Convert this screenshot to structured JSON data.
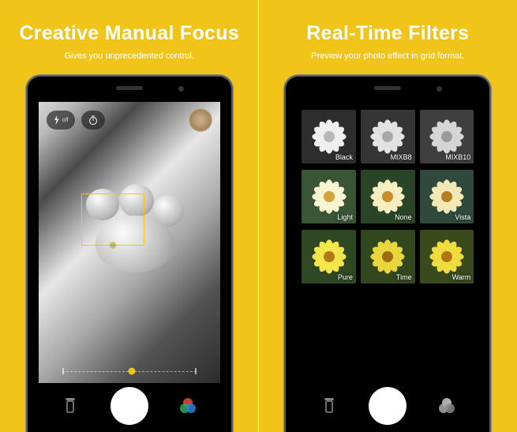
{
  "panels": {
    "left": {
      "title": "Creative Manual Focus",
      "subtitle": "Gives you unprecedented control.",
      "top_controls": {
        "flash_label": "off"
      }
    },
    "right": {
      "title": "Real-Time Filters",
      "subtitle": "Preview your photo effect in grid format.",
      "filters": [
        {
          "label": "Black",
          "bg": "#2d2d2d",
          "petal": "#efefef",
          "center": "#b8b8b8"
        },
        {
          "label": "MIXB8",
          "bg": "#353535",
          "petal": "#e2e2e2",
          "center": "#a8a8a8"
        },
        {
          "label": "MIXB10",
          "bg": "#3f3f3f",
          "petal": "#d5d5d5",
          "center": "#9a9a9a"
        },
        {
          "label": "Light",
          "bg": "#3a5436",
          "petal": "#f8f4d2",
          "center": "#d6a23a"
        },
        {
          "label": "None",
          "bg": "#294427",
          "petal": "#f6eec0",
          "center": "#c98e28"
        },
        {
          "label": "Vista",
          "bg": "#2f4a3c",
          "petal": "#f2e8b6",
          "center": "#b87f22"
        },
        {
          "label": "Pure",
          "bg": "#2e4823",
          "petal": "#f4e64a",
          "center": "#b07a16"
        },
        {
          "label": "Time",
          "bg": "#33471f",
          "petal": "#e8d63c",
          "center": "#a06c12"
        },
        {
          "label": "Warm",
          "bg": "#3a4a1c",
          "petal": "#efdc3e",
          "center": "#b3760f"
        }
      ]
    }
  }
}
